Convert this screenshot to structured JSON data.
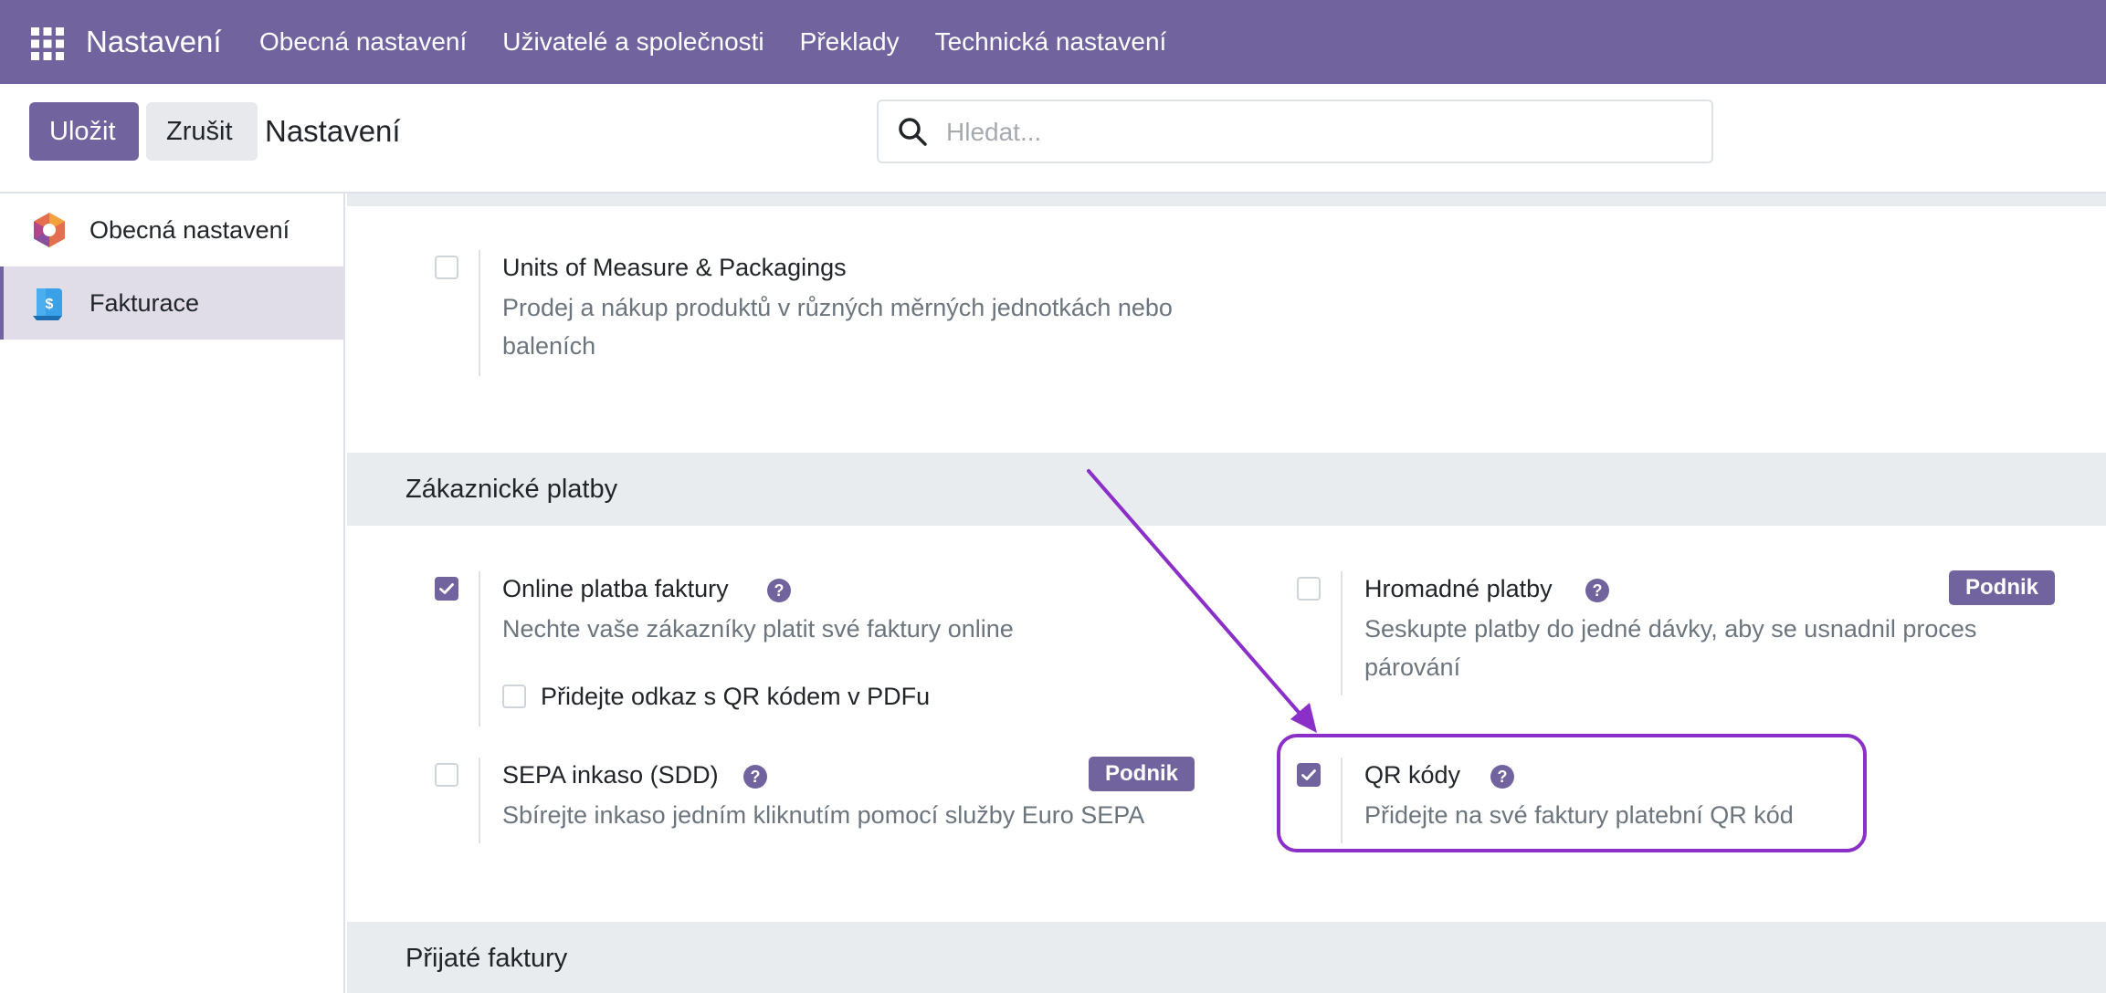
{
  "navbar": {
    "app_title": "Nastavení",
    "items": [
      {
        "label": "Obecná nastavení"
      },
      {
        "label": "Uživatelé a společnosti"
      },
      {
        "label": "Překlady"
      },
      {
        "label": "Technická nastavení"
      }
    ]
  },
  "control": {
    "save_label": "Uložit",
    "cancel_label": "Zrušit",
    "title": "Nastavení",
    "search_placeholder": "Hledat..."
  },
  "sidebar": {
    "items": [
      {
        "label": "Obecná nastavení",
        "active": false
      },
      {
        "label": "Fakturace",
        "active": true
      }
    ]
  },
  "main": {
    "uom": {
      "title": "Units of Measure & Packagings",
      "desc": "Prodej a nákup produktů v různých měrných jednotkách nebo baleních",
      "checked": false
    },
    "section_customer_payments": "Zákaznické platby",
    "online_payment": {
      "title": "Online platba faktury",
      "desc": "Nechte vaše zákazníky platit své faktury online",
      "checked": true,
      "sub_option": {
        "label": "Přidejte odkaz s QR kódem v PDFu",
        "checked": false
      }
    },
    "batch_payments": {
      "title": "Hromadné platby",
      "desc": "Seskupte platby do jedné dávky, aby se usnadnil proces párování",
      "badge": "Podnik",
      "checked": false
    },
    "sepa": {
      "title": "SEPA inkaso (SDD)",
      "desc": "Sbírejte inkaso jedním kliknutím pomocí služby Euro SEPA",
      "badge": "Podnik",
      "checked": false
    },
    "qr_codes": {
      "title": "QR kódy",
      "desc": "Přidejte na své faktury platební QR kód",
      "checked": true
    },
    "section_vendor_bills": "Přijaté faktury"
  },
  "colors": {
    "brand": "#71639e",
    "highlight": "#8b2fc9",
    "section_bg": "#e9ecef"
  }
}
